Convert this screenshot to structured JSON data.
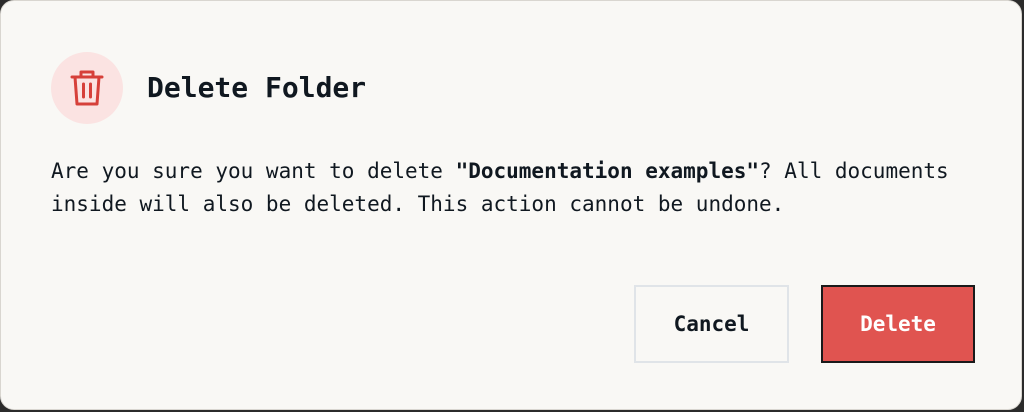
{
  "dialog": {
    "title": "Delete Folder",
    "message_prefix": "Are you sure you want to delete ",
    "folder_name": "\"Documentation examples\"",
    "message_suffix": "? All documents inside will also be deleted. This action cannot be undone.",
    "cancel_label": "Cancel",
    "delete_label": "Delete",
    "icon": "trash-icon"
  },
  "colors": {
    "background": "#f9f8f5",
    "icon_circle": "#fbe3e2",
    "icon_stroke": "#d6403a",
    "danger": "#e05450",
    "text": "#101820"
  }
}
